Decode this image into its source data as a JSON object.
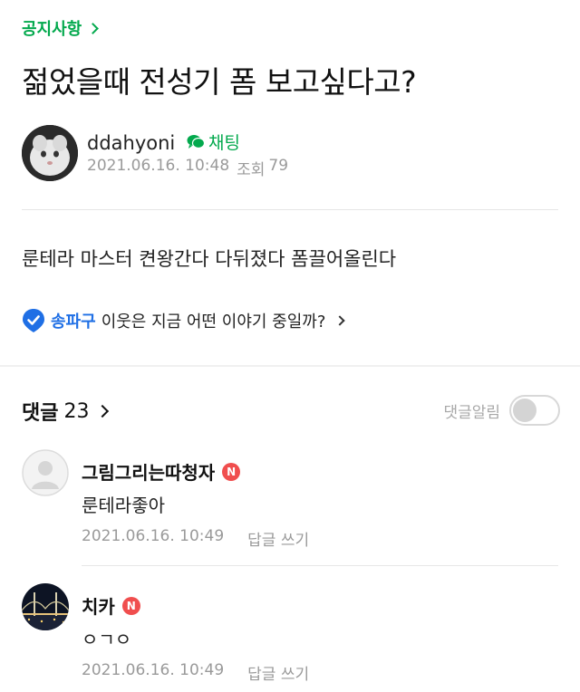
{
  "board": {
    "category": "공지사항"
  },
  "post": {
    "title": "젊었을때 전성기 폼 보고싶다고?",
    "author": "ddahyoni",
    "chat_label": "채팅",
    "date": "2021.06.16. 10:48",
    "views_label": "조회",
    "views": "79",
    "body": "룬테라 마스터 켠왕간다 다뒤졌다 폼끌어올린다"
  },
  "neighbor": {
    "location": "송파구",
    "question": "이웃은 지금 어떤 이야기 중일까?"
  },
  "comments_section": {
    "label": "댓글",
    "count": "23",
    "notify_label": "댓글알림",
    "notify_on": false
  },
  "comments": [
    {
      "author": "그림그리는따청자",
      "badge": "N",
      "text": "룬테라좋아",
      "date": "2021.06.16. 10:49",
      "reply_label": "답글 쓰기"
    },
    {
      "author": "치카",
      "badge": "N",
      "text": "ㅇㄱㅇ",
      "date": "2021.06.16. 10:49",
      "reply_label": "답글 쓰기"
    }
  ],
  "colors": {
    "accent_green": "#03a94d",
    "location_blue": "#1f6fe5",
    "badge_red": "#f04e4e"
  }
}
